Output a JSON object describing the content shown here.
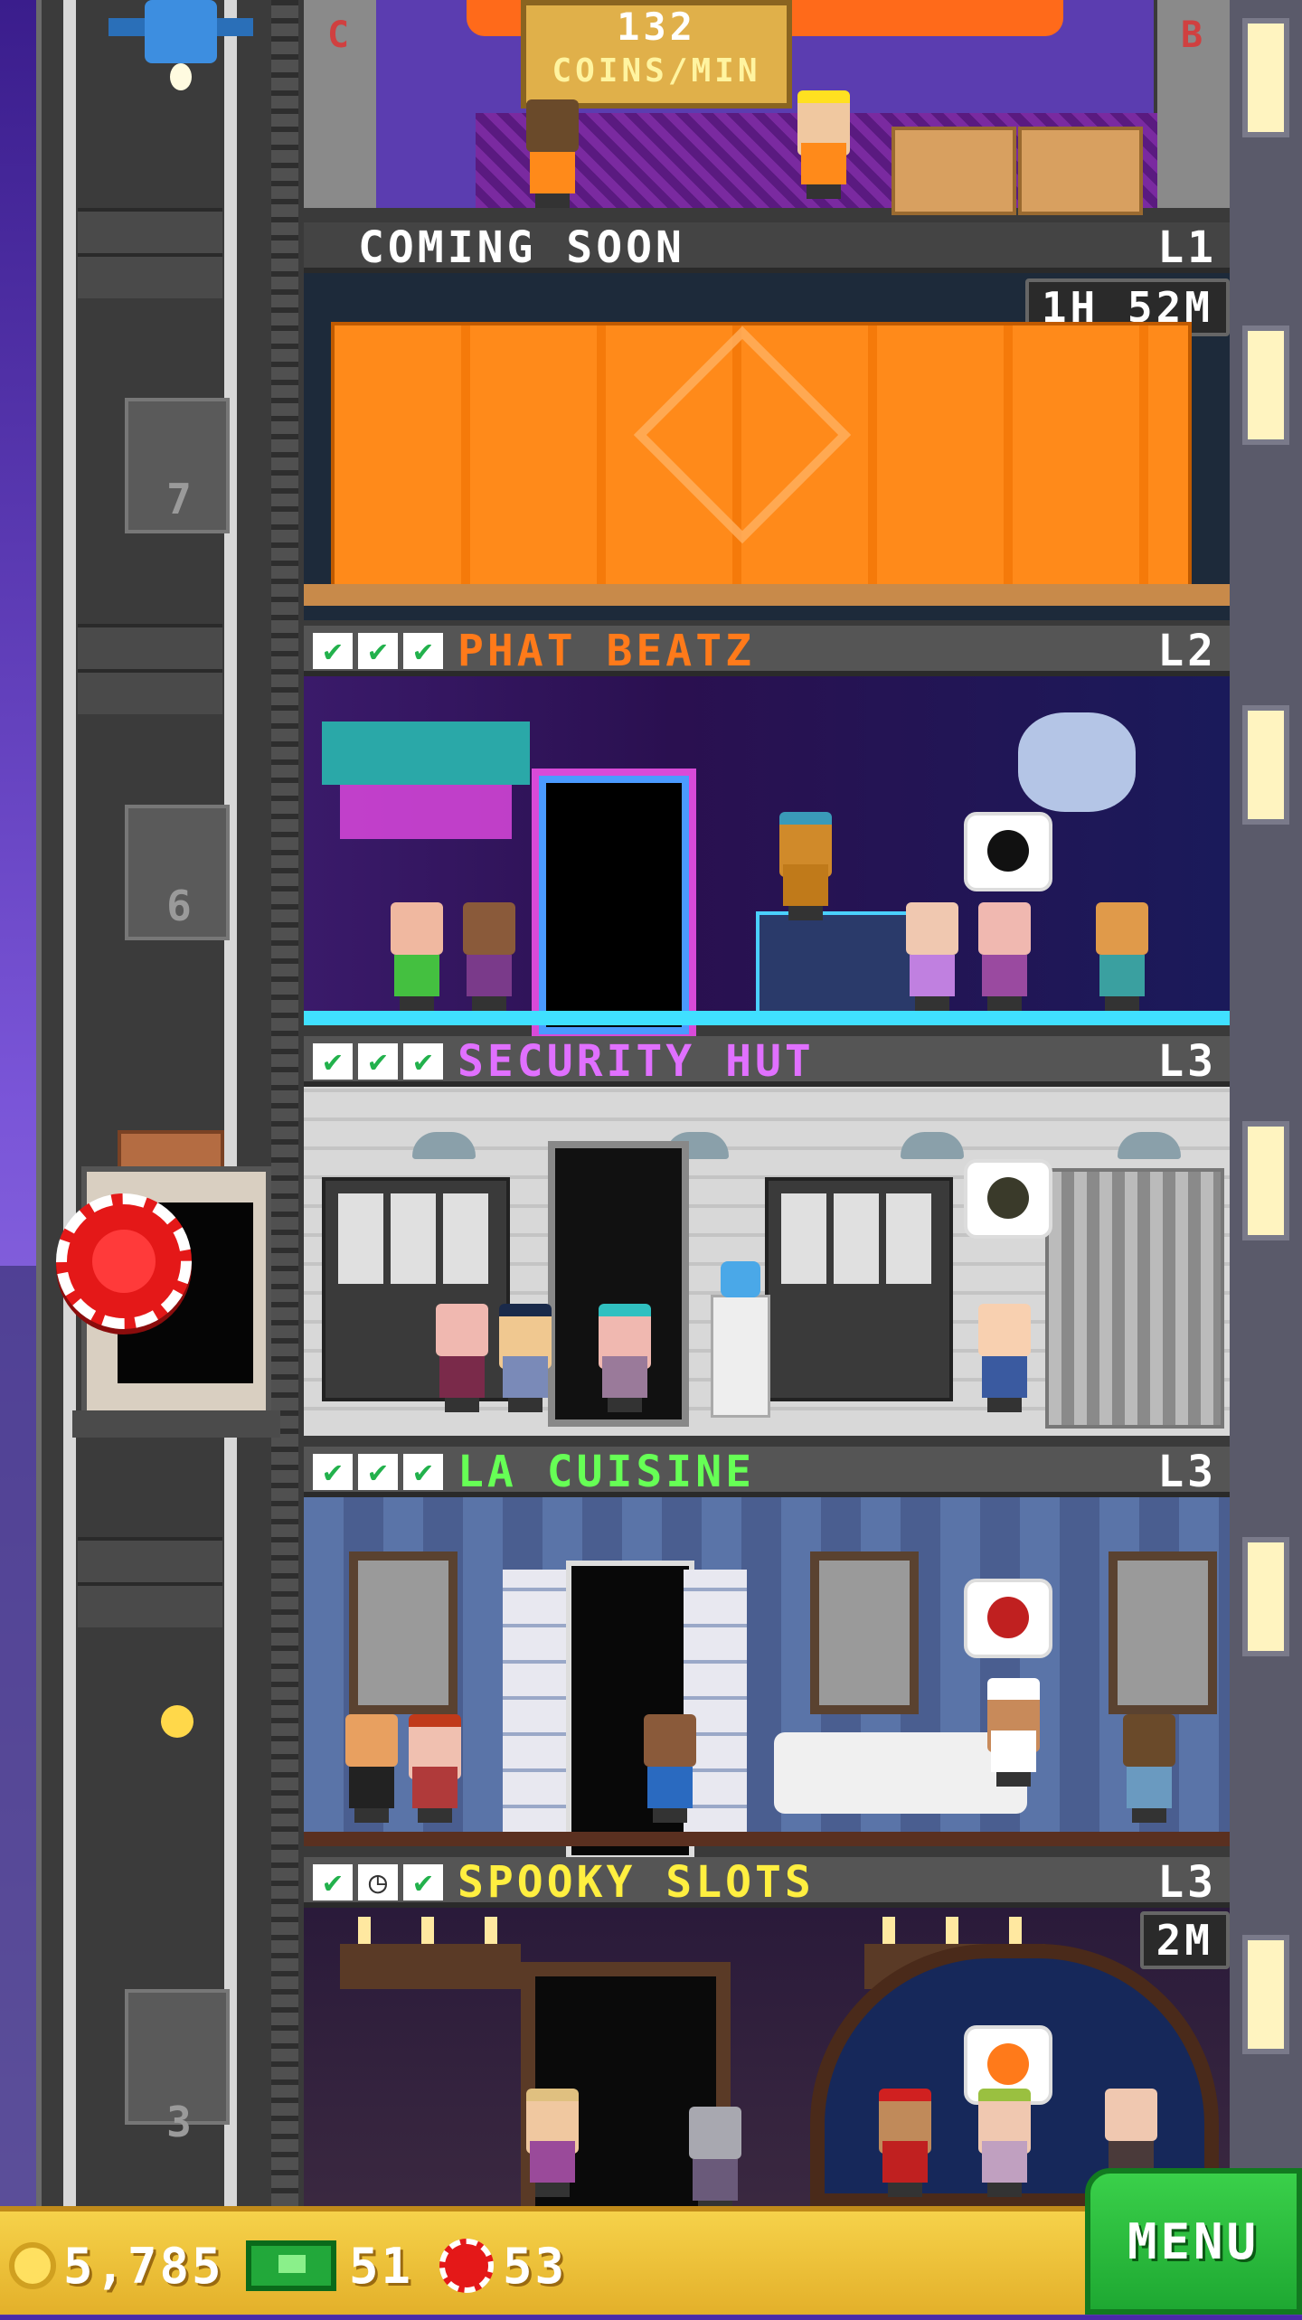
{
  "top_floor": {
    "rate_amount": "132",
    "rate_unit": "COINS/MIN",
    "pole_left_letter": "C",
    "pole_right_letter": "B"
  },
  "shaft": {
    "floor_numbers": [
      "7",
      "6",
      "3"
    ]
  },
  "floors": [
    {
      "id": "coming-soon",
      "name": "COMING SOON",
      "level": "L1",
      "timer": "1H 52M",
      "checks": []
    },
    {
      "id": "phat-beatz",
      "name": "PHAT BEATZ",
      "level": "L2",
      "checks": [
        "✔",
        "✔",
        "✔"
      ],
      "name_color": "#ff7a1a"
    },
    {
      "id": "security-hut",
      "name": "SECURITY HUT",
      "level": "L3",
      "checks": [
        "✔",
        "✔",
        "✔"
      ],
      "name_color": "#e070ff"
    },
    {
      "id": "la-cuisine",
      "name": "LA CUISINE",
      "level": "L3",
      "checks": [
        "✔",
        "✔",
        "✔"
      ],
      "name_color": "#66ff55"
    },
    {
      "id": "spooky-slots",
      "name": "SPOOKY SLOTS",
      "level": "L3",
      "timer": "2M",
      "checks": [
        "✔",
        "◷",
        "✔"
      ],
      "name_color": "#ffef40"
    }
  ],
  "icons": {
    "coin": "coin-icon",
    "bux": "bux-icon",
    "chip": "chip-icon",
    "check": "check-icon",
    "clock": "clock-icon",
    "construction": "construction-sign-icon"
  },
  "bottom_bar": {
    "coins": "5,785",
    "bux": "51",
    "chips": "53",
    "menu_label": "MENU"
  },
  "colors": {
    "menu_green": "#1ea832",
    "bar_gold": "#f6d24a",
    "chip_red": "#e41818",
    "check_green": "#22b14c"
  }
}
